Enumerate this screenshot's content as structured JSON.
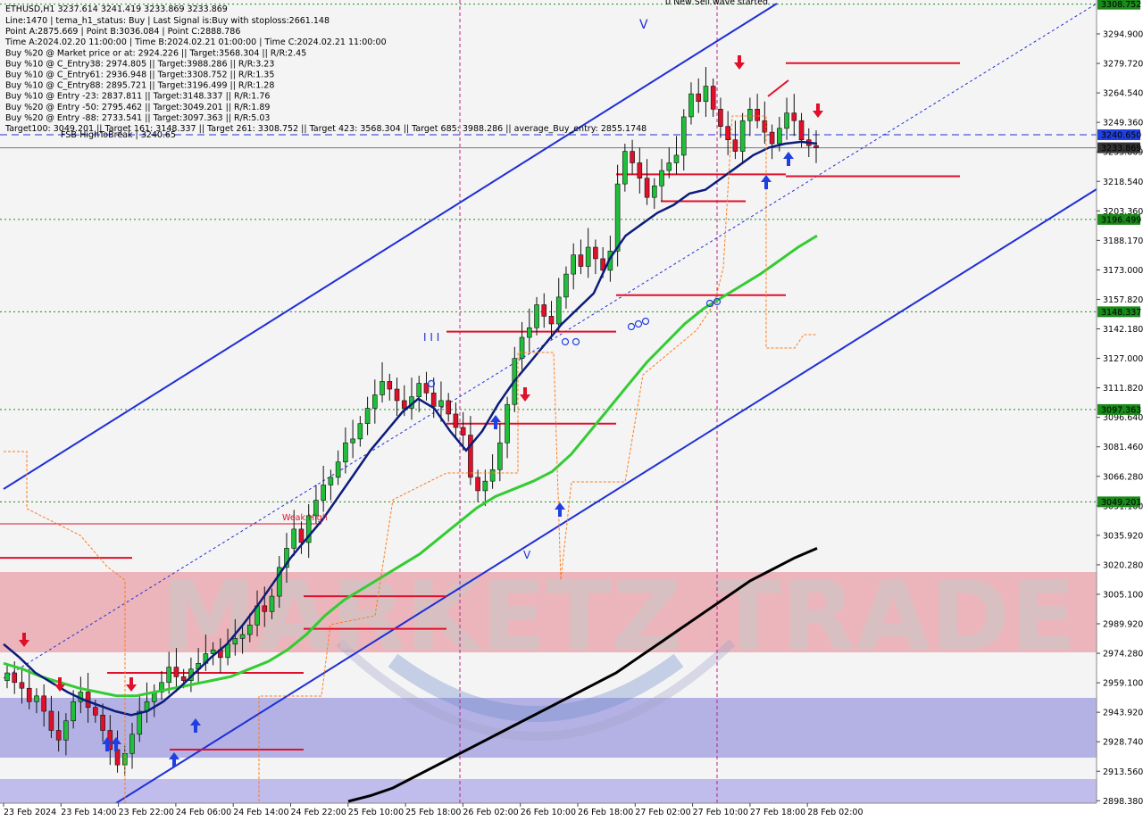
{
  "window": {
    "title": "ETHUSD,H1  3237.614 3241.419 3233.869 3233.869"
  },
  "info_lines": [
    "Line:1470 | tema_h1_status: Buy | Last Signal is:Buy with stoploss:2661.148",
    "Point A:2875.669 | Point B:3036.084 | Point C:2888.786",
    "Time A:2024.02.20 11:00:00 | Time B:2024.02.21 01:00:00 | Time C:2024.02.21 11:00:00",
    "Buy %20 @ Market price or at: 2924.226 || Target:3568.304 || R/R:2.45",
    "Buy %10 @ C_Entry38: 2974.805 || Target:3988.286 || R/R:3.23",
    "Buy %10 @ C_Entry61: 2936.948 || Target:3308.752 || R/R:1.35",
    "Buy %10 @ C_Entry88: 2895.721 || Target:3196.499 || R/R:1.28",
    "Buy %10 @ Entry -23: 2837.811 || Target:3148.337 || R/R:1.76",
    "Buy %20 @ Entry -50: 2795.462 || Target:3049.201 || R/R:1.89",
    "Buy %20 @ Entry -88: 2733.541 || Target:3097.363 || R/R:5.03",
    "Target100: 3049.201 || Target 161: 3148.337 || Target 261: 3308.752 || Target 423: 3568.304 || Target 685: 3988.286 || average_Buy_entry: 2855.1748"
  ],
  "annotations": {
    "fsb_label": "FSB-HighToBreak | 3240.65",
    "weak_high": "Weak High",
    "wave_text": "0 New Sell wave started",
    "wave_mark_v": "V",
    "wave_mark_iii": "I I I",
    "watermark": "MARKETZ TRADE"
  },
  "price_axis": {
    "ticks": [
      "3294.900",
      "3279.720",
      "3264.540",
      "3249.360",
      "3233.869",
      "3218.540",
      "3203.360",
      "3188.170",
      "3173.000",
      "3157.820",
      "3142.180",
      "3127.000",
      "3111.820",
      "3096.640",
      "3081.460",
      "3066.280",
      "3051.100",
      "3035.920",
      "3020.280",
      "3005.100",
      "2989.920",
      "2974.280",
      "2959.100",
      "2943.920",
      "2928.740",
      "2913.560",
      "2898.380"
    ]
  },
  "price_tags": [
    {
      "value": "3308.752",
      "color": "#1a8a1a"
    },
    {
      "value": "3240.650",
      "color": "#1f3fe0"
    },
    {
      "value": "3233.869",
      "color": "#333333"
    },
    {
      "value": "3196.499",
      "color": "#1a8a1a"
    },
    {
      "value": "3148.337",
      "color": "#1a8a1a"
    },
    {
      "value": "3097.363",
      "color": "#1a8a1a"
    },
    {
      "value": "3049.201",
      "color": "#1a8a1a"
    }
  ],
  "time_axis": [
    "23 Feb 2024",
    "23 Feb 14:00",
    "23 Feb 22:00",
    "24 Feb 06:00",
    "24 Feb 14:00",
    "24 Feb 22:00",
    "25 Feb 10:00",
    "25 Feb 18:00",
    "26 Feb 02:00",
    "26 Feb 10:00",
    "26 Feb 18:00",
    "27 Feb 02:00",
    "27 Feb 10:00",
    "27 Feb 18:00",
    "28 Feb 02:00"
  ],
  "colors": {
    "up": "#1fbf3a",
    "down": "#e0102a",
    "target": "#1a8a1a",
    "channel": "#1f2fd6",
    "ma_fast": "#0c1c7a",
    "ma_mid": "#33cc33",
    "ma_slow": "#000000",
    "trail": "#ff7a1a"
  },
  "chart_data": {
    "type": "candlestick",
    "symbol": "ETHUSD",
    "timeframe": "H1",
    "y_range": [
      2893,
      3310
    ],
    "target_levels": [
      3308.752,
      3196.499,
      3148.337,
      3097.363,
      3049.201
    ],
    "fsb_level": 3240.65,
    "last_price": 3233.869,
    "closes": [
      2960,
      2955,
      2952,
      2945,
      2948,
      2940,
      2930,
      2925,
      2935,
      2945,
      2950,
      2942,
      2938,
      2930,
      2920,
      2912,
      2918,
      2928,
      2940,
      2945,
      2950,
      2955,
      2963,
      2958,
      2956,
      2962,
      2965,
      2970,
      2972,
      2968,
      2975,
      2978,
      2980,
      2985,
      2995,
      2992,
      3000,
      3015,
      3025,
      3035,
      3028,
      3042,
      3050,
      3058,
      3062,
      3070,
      3080,
      3082,
      3090,
      3098,
      3105,
      3112,
      3108,
      3102,
      3098,
      3104,
      3111,
      3106,
      3099,
      3102,
      3095,
      3088,
      3084,
      3062,
      3055,
      3060,
      3066,
      3080,
      3100,
      3124,
      3135,
      3140,
      3152,
      3146,
      3142,
      3156,
      3168,
      3178,
      3172,
      3182,
      3176,
      3170,
      3180,
      3215,
      3232,
      3226,
      3218,
      3208,
      3214,
      3222,
      3226,
      3230,
      3250,
      3262,
      3258,
      3266,
      3254,
      3245,
      3238,
      3232,
      3248,
      3254,
      3248,
      3242,
      3236,
      3244,
      3252,
      3248,
      3238,
      3235,
      3233.869
    ],
    "ma_fast": [
      2975,
      2968,
      2960,
      2955,
      2950,
      2946,
      2943,
      2940,
      2938,
      2940,
      2945,
      2952,
      2960,
      2968,
      2975,
      2985,
      2996,
      3008,
      3020,
      3030,
      3040,
      3052,
      3064,
      3076,
      3086,
      3096,
      3103,
      3098,
      3086,
      3076,
      3086,
      3100,
      3112,
      3122,
      3132,
      3142,
      3150,
      3158,
      3176,
      3188,
      3194,
      3200,
      3204,
      3210,
      3212,
      3218,
      3224,
      3230,
      3234,
      3236,
      3237,
      3236
    ],
    "ma_mid": [
      2965,
      2962,
      2958,
      2955,
      2952,
      2950,
      2948,
      2948,
      2950,
      2952,
      2954,
      2956,
      2958,
      2962,
      2966,
      2972,
      2980,
      2990,
      2998,
      3004,
      3010,
      3016,
      3022,
      3030,
      3038,
      3046,
      3052,
      3056,
      3060,
      3065,
      3074,
      3086,
      3098,
      3110,
      3122,
      3132,
      3142,
      3150,
      3156,
      3162,
      3168,
      3175,
      3182,
      3188
    ],
    "ma_slow": [
      2893,
      2896,
      2900,
      2906,
      2912,
      2918,
      2924,
      2930,
      2936,
      2942,
      2948,
      2954,
      2960,
      2968,
      2976,
      2984,
      2992,
      3000,
      3008,
      3014,
      3020,
      3025
    ]
  }
}
